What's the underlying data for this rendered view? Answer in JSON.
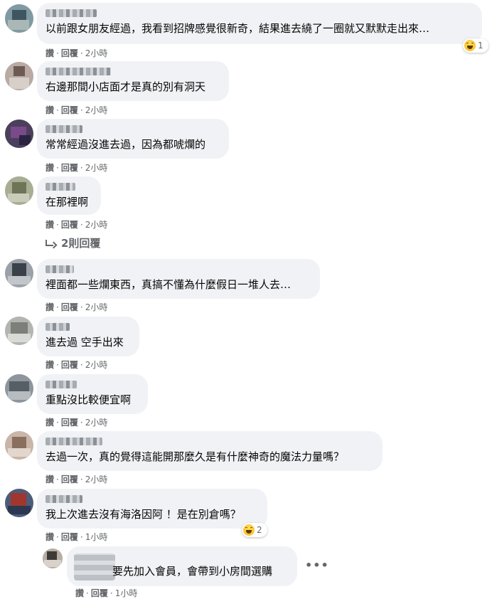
{
  "comments": [
    {
      "text": "以前跟女朋友經過，我看到招牌感覺很新奇，結果進去繞了一圈就又默默走出來…",
      "like": "讚",
      "reply": "回覆",
      "time": "2小時",
      "reaction_count": "1"
    },
    {
      "text": "右邊那間小店面才是真的別有洞天",
      "like": "讚",
      "reply": "回覆",
      "time": "2小時"
    },
    {
      "text": "常常經過沒進去過，因為都唬爛的",
      "like": "讚",
      "reply": "回覆",
      "time": "2小時"
    },
    {
      "text": "在那裡啊",
      "like": "讚",
      "reply": "回覆",
      "time": "2小時"
    },
    {
      "text": "裡面都一些爛東西，真搞不懂為什麼假日一堆人去…",
      "like": "讚",
      "reply": "回覆",
      "time": "2小時"
    },
    {
      "text": "進去過 空手出來",
      "like": "讚",
      "reply": "回覆",
      "time": "2小時"
    },
    {
      "text": "重點沒比較便宜啊",
      "like": "讚",
      "reply": "回覆",
      "time": "2小時"
    },
    {
      "text": "去過一次，真的覺得這能開那麼久是有什麼神奇的魔法力量嗎？",
      "like": "讚",
      "reply": "回覆",
      "time": "2小時"
    },
    {
      "text": "我上次進去沒有海洛因阿 ！是在別倉嗎？",
      "like": "讚",
      "reply": "回覆",
      "time": "1小時",
      "reaction_count": "2"
    }
  ],
  "view_replies": "2則回覆",
  "reply_comment": {
    "text": "要先加入會員，會帶到小房間選購",
    "like": "讚",
    "reply": "回覆",
    "time": "1小時"
  },
  "more_icon": "more-options-icon",
  "colors": {
    "bubble": "#f0f2f5",
    "meta": "#65676b",
    "text": "#050505"
  }
}
